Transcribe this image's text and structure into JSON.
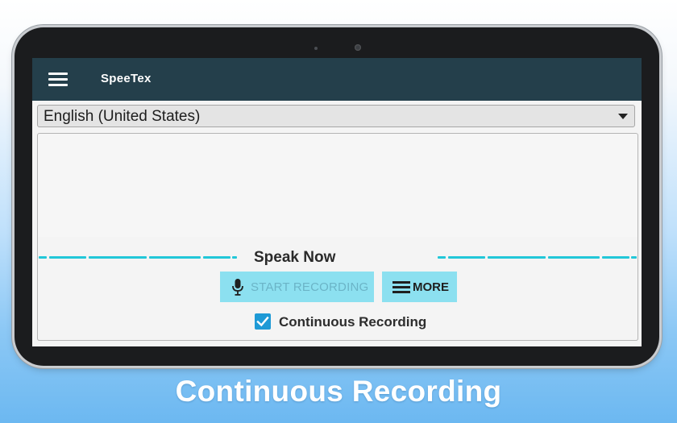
{
  "app": {
    "title": "SpeeTex"
  },
  "language_select": {
    "value": "English (United States)"
  },
  "recording": {
    "speak_now": "Speak Now",
    "start_label": "START RECORDING",
    "more_label": "MORE",
    "continuous_label": "Continuous Recording",
    "continuous_checked": true
  },
  "caption": "Continuous Recording",
  "icons": {
    "menu": "hamburger-menu-icon",
    "dropdown": "dropdown-arrow-icon",
    "mic": "microphone-icon",
    "more": "menu-lines-icon",
    "check": "checkmark-icon"
  },
  "colors": {
    "appbar": "#243f4b",
    "button": "#8ce0f0",
    "wave": "#22c7d8",
    "checkbox": "#1e9ad6"
  }
}
